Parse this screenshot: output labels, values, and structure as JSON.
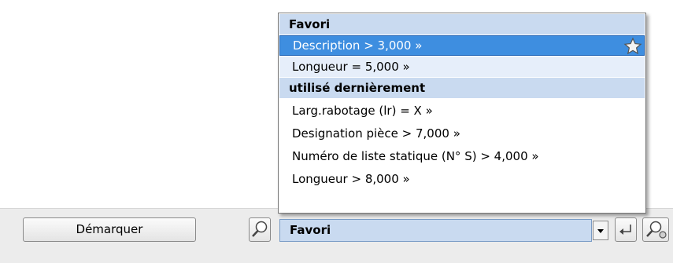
{
  "dropdown": {
    "header_favorites": "Favori",
    "favorites": [
      "Description > 3,000 »",
      "Longueur =  5,000 »"
    ],
    "header_recent": "utilisé dernièrement",
    "recent": [
      "Larg.rabotage (lr) = X »",
      "Designation pièce > 7,000 »",
      "Numéro de liste statique (N° S) > 4,000 »",
      "Longueur >  8,000 »"
    ],
    "selected_index": 0
  },
  "toolbar": {
    "unmark_label": "Démarquer",
    "filter_value": "Favori"
  },
  "icons": {
    "search": "search-icon",
    "star": "star-icon",
    "dropdown_arrow": "chevron-down-icon",
    "enter": "enter-icon",
    "settings": "search-settings-icon"
  },
  "colors": {
    "selection": "#3e8ee0",
    "header_bg": "#c9daf0"
  }
}
